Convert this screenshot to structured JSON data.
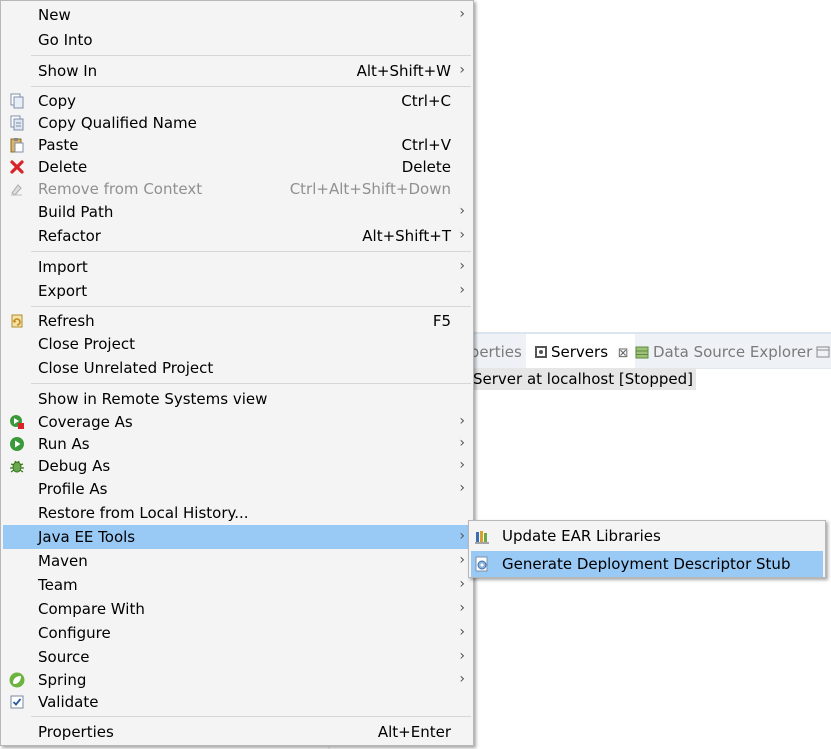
{
  "background": {
    "tabs": {
      "properties": "Properties",
      "servers": "Servers",
      "data_source": "Data Source Explorer"
    },
    "server_entry": "Server at localhost  [Stopped]"
  },
  "menu": {
    "new": "New",
    "go_into": "Go Into",
    "show_in": "Show In",
    "show_in_sc": "Alt+Shift+W",
    "copy": "Copy",
    "copy_sc": "Ctrl+C",
    "copy_qualified": "Copy Qualified Name",
    "paste": "Paste",
    "paste_sc": "Ctrl+V",
    "delete": "Delete",
    "delete_sc": "Delete",
    "remove_context": "Remove from Context",
    "remove_context_sc": "Ctrl+Alt+Shift+Down",
    "build_path": "Build Path",
    "refactor": "Refactor",
    "refactor_sc": "Alt+Shift+T",
    "import": "Import",
    "export": "Export",
    "refresh": "Refresh",
    "refresh_sc": "F5",
    "close_project": "Close Project",
    "close_unrelated": "Close Unrelated Project",
    "show_remote": "Show in Remote Systems view",
    "coverage_as": "Coverage As",
    "run_as": "Run As",
    "debug_as": "Debug As",
    "profile_as": "Profile As",
    "restore_history": "Restore from Local History...",
    "java_ee_tools": "Java EE Tools",
    "maven": "Maven",
    "team": "Team",
    "compare_with": "Compare With",
    "configure": "Configure",
    "source": "Source",
    "spring": "Spring",
    "validate": "Validate",
    "properties": "Properties",
    "properties_sc": "Alt+Enter",
    "arrow": "›"
  },
  "submenu": {
    "update_ear": "Update EAR Libraries",
    "generate_dd": "Generate Deployment Descriptor Stub"
  }
}
